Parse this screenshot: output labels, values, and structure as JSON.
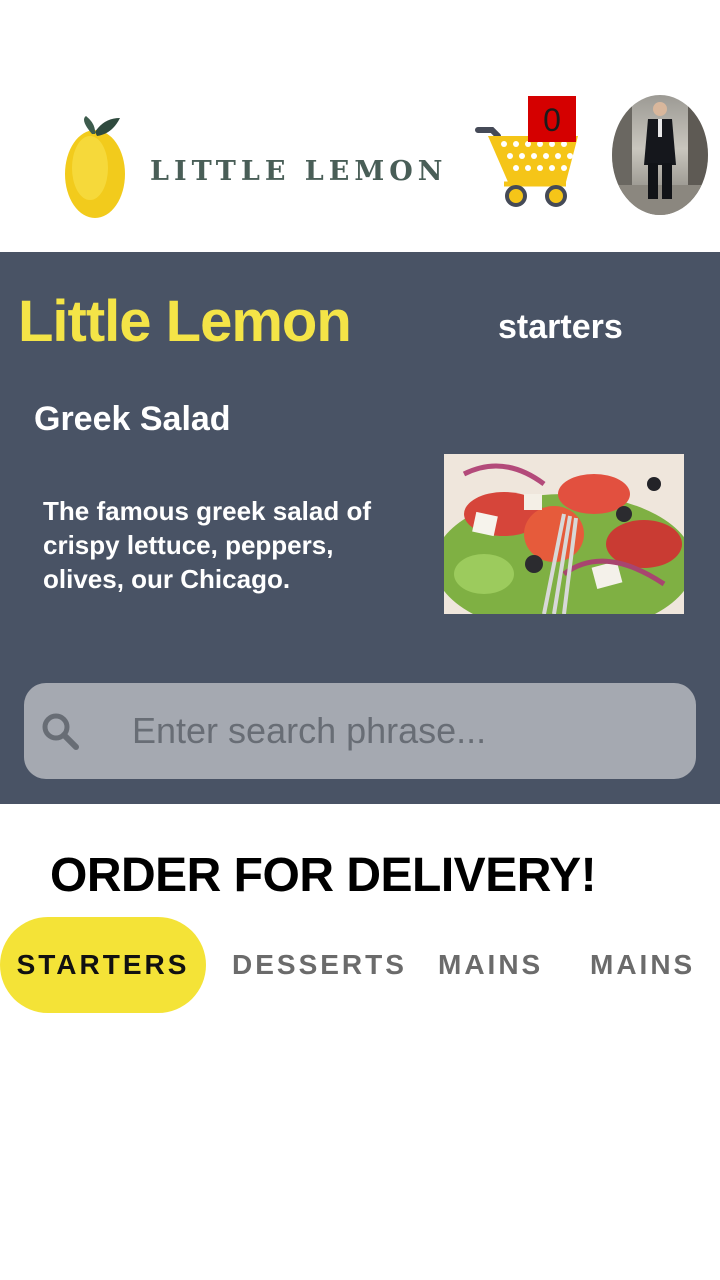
{
  "header": {
    "logo_text": "LITTLE LEMON",
    "cart_count": "0"
  },
  "hero": {
    "title": "Little Lemon",
    "category": "starters",
    "dish_name": "Greek Salad",
    "dish_description": "The famous greek salad of crispy lettuce, peppers, olives, our Chicago.",
    "search_placeholder": "Enter search phrase..."
  },
  "order": {
    "heading": "ORDER FOR DELIVERY!",
    "tabs": [
      {
        "label": "STARTERS",
        "active": true
      },
      {
        "label": "DESSERTS",
        "active": false
      },
      {
        "label": "MAINS",
        "active": false
      },
      {
        "label": "MAINS",
        "active": false
      }
    ]
  },
  "icons": {
    "logo": "lemon-icon",
    "cart": "shopping-cart-icon",
    "search": "search-icon"
  },
  "colors": {
    "brand_yellow": "#f4e447",
    "hero_background": "#495365",
    "search_background": "#a5a9b1",
    "cart_badge": "#d50000",
    "active_tab": "#f4e337"
  }
}
